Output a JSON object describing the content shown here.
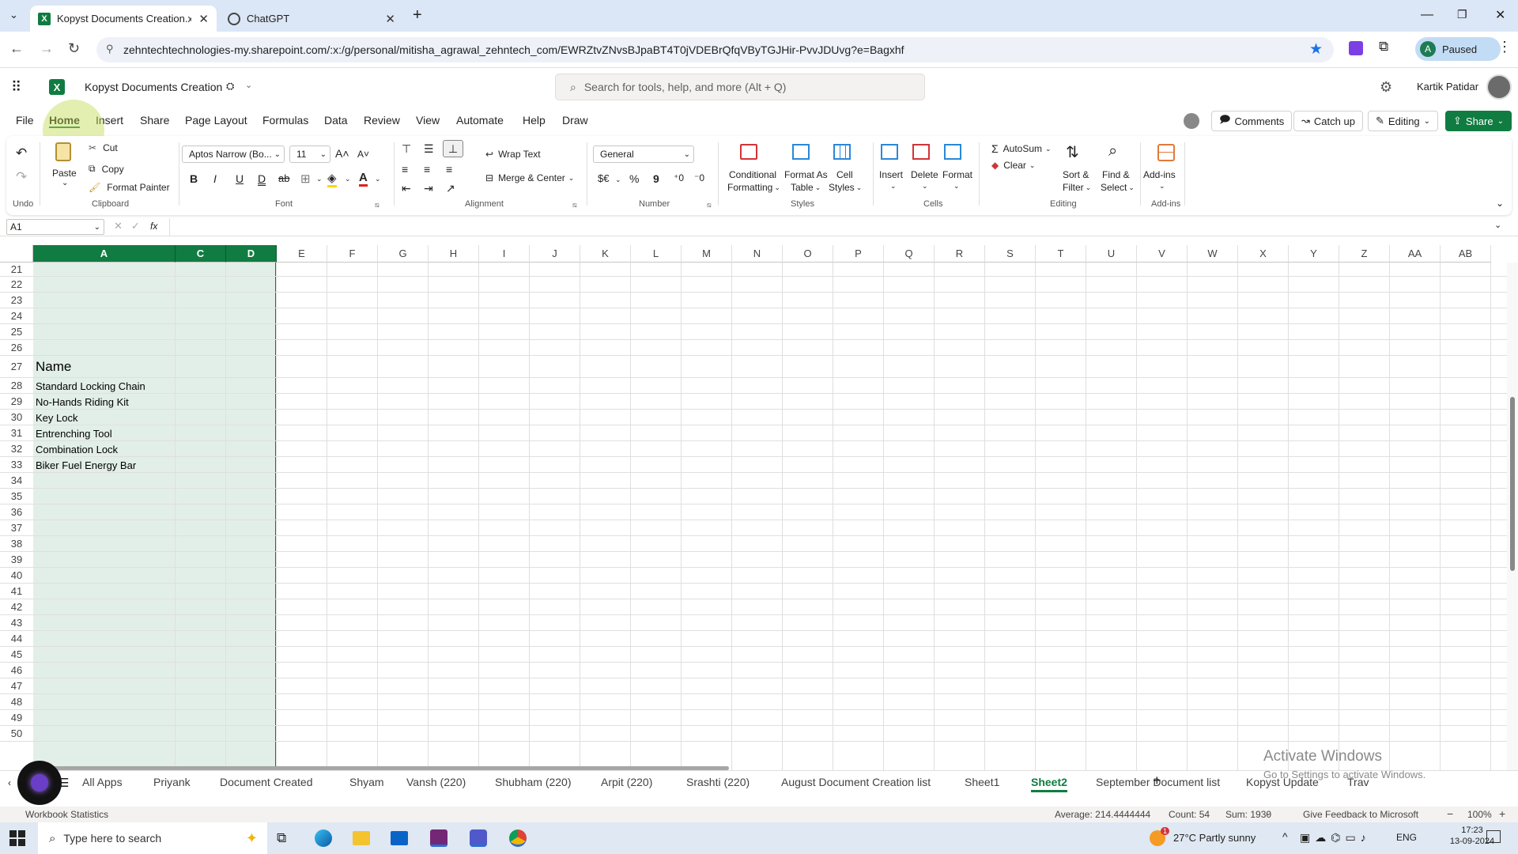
{
  "browser": {
    "tabs": [
      {
        "title": "Kopyst Documents Creation.xls"
      },
      {
        "title": "ChatGPT"
      }
    ],
    "url": "zehntechtechnologies-my.sharepoint.com/:x:/g/personal/mitisha_agrawal_zehntech_com/EWRZtvZNvsBJpaBT4T0jVDEBrQfqVByTGJHir-PvvJDUvg?e=Bagxhf",
    "profile_initial": "A",
    "profile_status": "Paused"
  },
  "excel": {
    "doc_title": "Kopyst Documents Creation",
    "search_placeholder": "Search for tools, help, and more (Alt + Q)",
    "user_name": "Kartik Patidar",
    "menu": [
      "File",
      "Home",
      "Insert",
      "Share",
      "Page Layout",
      "Formulas",
      "Data",
      "Review",
      "View",
      "Automate",
      "Help",
      "Draw"
    ],
    "comments_label": "Comments",
    "catchup_label": "Catch up",
    "editing_label": "Editing",
    "share_label": "Share"
  },
  "ribbon": {
    "undo_group": "Undo",
    "paste": "Paste",
    "cut": "Cut",
    "copy": "Copy",
    "format_painter": "Format Painter",
    "clipboard_group": "Clipboard",
    "font_name": "Aptos Narrow (Bo...",
    "font_size": "11",
    "bold": "B",
    "italic": "I",
    "underline": "U",
    "double_underline": "D",
    "strike": "ab",
    "font_group": "Font",
    "wrap_text": "Wrap Text",
    "merge_center": "Merge & Center",
    "alignment_group": "Alignment",
    "number_format": "General",
    "currency": "$€",
    "percent": "%",
    "comma": "9",
    "number_group": "Number",
    "conditional_1": "Conditional",
    "conditional_2": "Formatting",
    "format_table_1": "Format As",
    "format_table_2": "Table",
    "cell_styles_1": "Cell",
    "cell_styles_2": "Styles",
    "styles_group": "Styles",
    "insert": "Insert",
    "delete": "Delete",
    "format": "Format",
    "cells_group": "Cells",
    "autosum": "AutoSum",
    "clear": "Clear",
    "sort_1": "Sort &",
    "sort_2": "Filter",
    "find_1": "Find &",
    "find_2": "Select",
    "editing_group": "Editing",
    "addins": "Add-ins",
    "addins_group": "Add-ins"
  },
  "formula_bar": {
    "name_box": "A1",
    "fx": "fx",
    "formula": ""
  },
  "grid": {
    "columns": [
      "A",
      "C",
      "D",
      "E",
      "F",
      "G",
      "H",
      "I",
      "J",
      "K",
      "L",
      "M",
      "N",
      "O",
      "P",
      "Q",
      "R",
      "S",
      "T",
      "U",
      "V",
      "W",
      "X",
      "Y",
      "Z",
      "AA",
      "AB"
    ],
    "rows": [
      "21",
      "22",
      "23",
      "24",
      "25",
      "26",
      "27",
      "28",
      "29",
      "30",
      "31",
      "32",
      "33",
      "34",
      "35",
      "36",
      "37",
      "38",
      "39",
      "40",
      "41",
      "42",
      "43",
      "44",
      "45",
      "46",
      "47",
      "48",
      "49",
      "50"
    ],
    "header_cell": "Name",
    "items": [
      "Standard Locking Chain",
      "No-Hands Riding Kit",
      "Key Lock",
      "Entrenching Tool",
      "Combination Lock",
      "Biker Fuel Energy Bar"
    ]
  },
  "sheets": [
    "All Apps",
    "Priyank",
    "Document Created",
    "Shyam",
    "Vansh (220)",
    "Shubham (220)",
    "Arpit (220)",
    "Srashti (220)",
    "August Document Creation list",
    "Sheet1",
    "Sheet2",
    "September Document list",
    "Kopyst Update",
    "Trav"
  ],
  "active_sheet": "Sheet2",
  "watermark": {
    "line1": "Activate Windows",
    "line2": "Go to Settings to activate Windows."
  },
  "status": {
    "left": "Workbook Statistics",
    "average": "Average: 214.4444444",
    "count": "Count: 54",
    "sum": "Sum: 1930",
    "feedback": "Give Feedback to Microsoft",
    "zoom": "100%"
  },
  "taskbar": {
    "search_placeholder": "Type here to search",
    "weather": "27°C  Partly sunny",
    "lang": "ENG",
    "time": "17:23",
    "date": "13-09-2024",
    "weather_badge": "1"
  },
  "colors": {
    "excel_green": "#107c41",
    "selection": "#e2efe8",
    "tabstrip": "#dbe6f6"
  }
}
